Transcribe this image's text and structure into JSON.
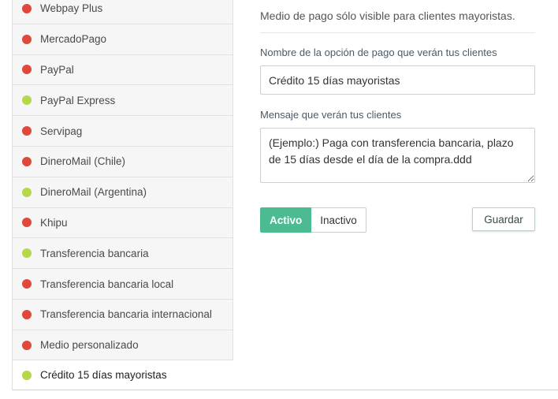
{
  "colors": {
    "status_red": "#e0483c",
    "status_green": "#b4d84a",
    "accent_green": "#4dbb91"
  },
  "payment_methods": [
    {
      "label": "Webpay Plus",
      "status": "red"
    },
    {
      "label": "MercadoPago",
      "status": "red"
    },
    {
      "label": "PayPal",
      "status": "red"
    },
    {
      "label": "PayPal Express",
      "status": "green"
    },
    {
      "label": "Servipag",
      "status": "red"
    },
    {
      "label": "DineroMail (Chile)",
      "status": "red"
    },
    {
      "label": "DineroMail (Argentina)",
      "status": "green"
    },
    {
      "label": "Khipu",
      "status": "red"
    },
    {
      "label": "Transferencia bancaria",
      "status": "green"
    },
    {
      "label": "Transferencia bancaria local",
      "status": "red"
    },
    {
      "label": "Transferencia bancaria internacional",
      "status": "red"
    },
    {
      "label": "Medio personalizado",
      "status": "red"
    }
  ],
  "selected_method": {
    "label": "Crédito 15 días mayoristas",
    "status": "green"
  },
  "form": {
    "description": "Medio de pago sólo visible para clientes mayoristas.",
    "name_label": "Nombre de la opción de pago que verán tus clientes",
    "name_value": "Crédito 15 días mayoristas",
    "message_label": "Mensaje que verán tus clientes",
    "message_value": "(Ejemplo:) Paga con transferencia bancaria, plazo de 15 días desde el día de la compra.ddd",
    "active_label": "Activo",
    "inactive_label": "Inactivo",
    "save_label": "Guardar"
  }
}
